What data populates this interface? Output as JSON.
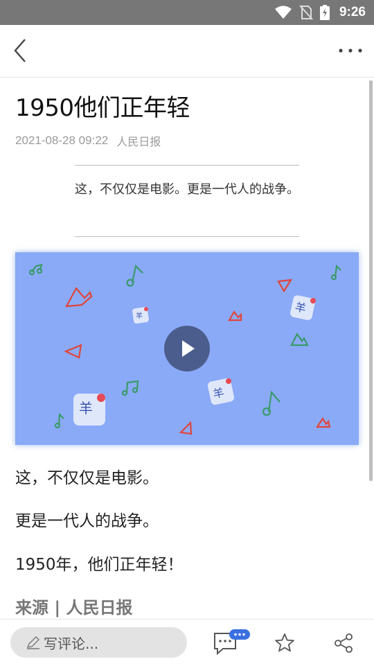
{
  "status_bar": {
    "time": "9:26",
    "icons": [
      "wifi-icon",
      "no-sim-icon",
      "battery-charging-icon"
    ]
  },
  "nav": {
    "back_icon": "chevron-left-icon",
    "more_icon": "more-horizontal-icon"
  },
  "article": {
    "title": "1950他们正年轻",
    "date": "2021-08-28 09:22",
    "publisher": "人民日报",
    "quote": "这，不仅仅是电影。更是一代人的战争。",
    "video": {
      "play_icon": "play-icon",
      "background": "#8aaaf7"
    },
    "paragraphs": [
      "这，不仅仅是电影。",
      "更是一代人的战争。",
      "1950年，他们正年轻！"
    ],
    "source_line": "来源 | 人民日报"
  },
  "bottom_bar": {
    "comment_placeholder": "写评论...",
    "icons": [
      "comment-icon",
      "star-icon",
      "share-icon"
    ],
    "badge_color": "#3a6fe0"
  }
}
